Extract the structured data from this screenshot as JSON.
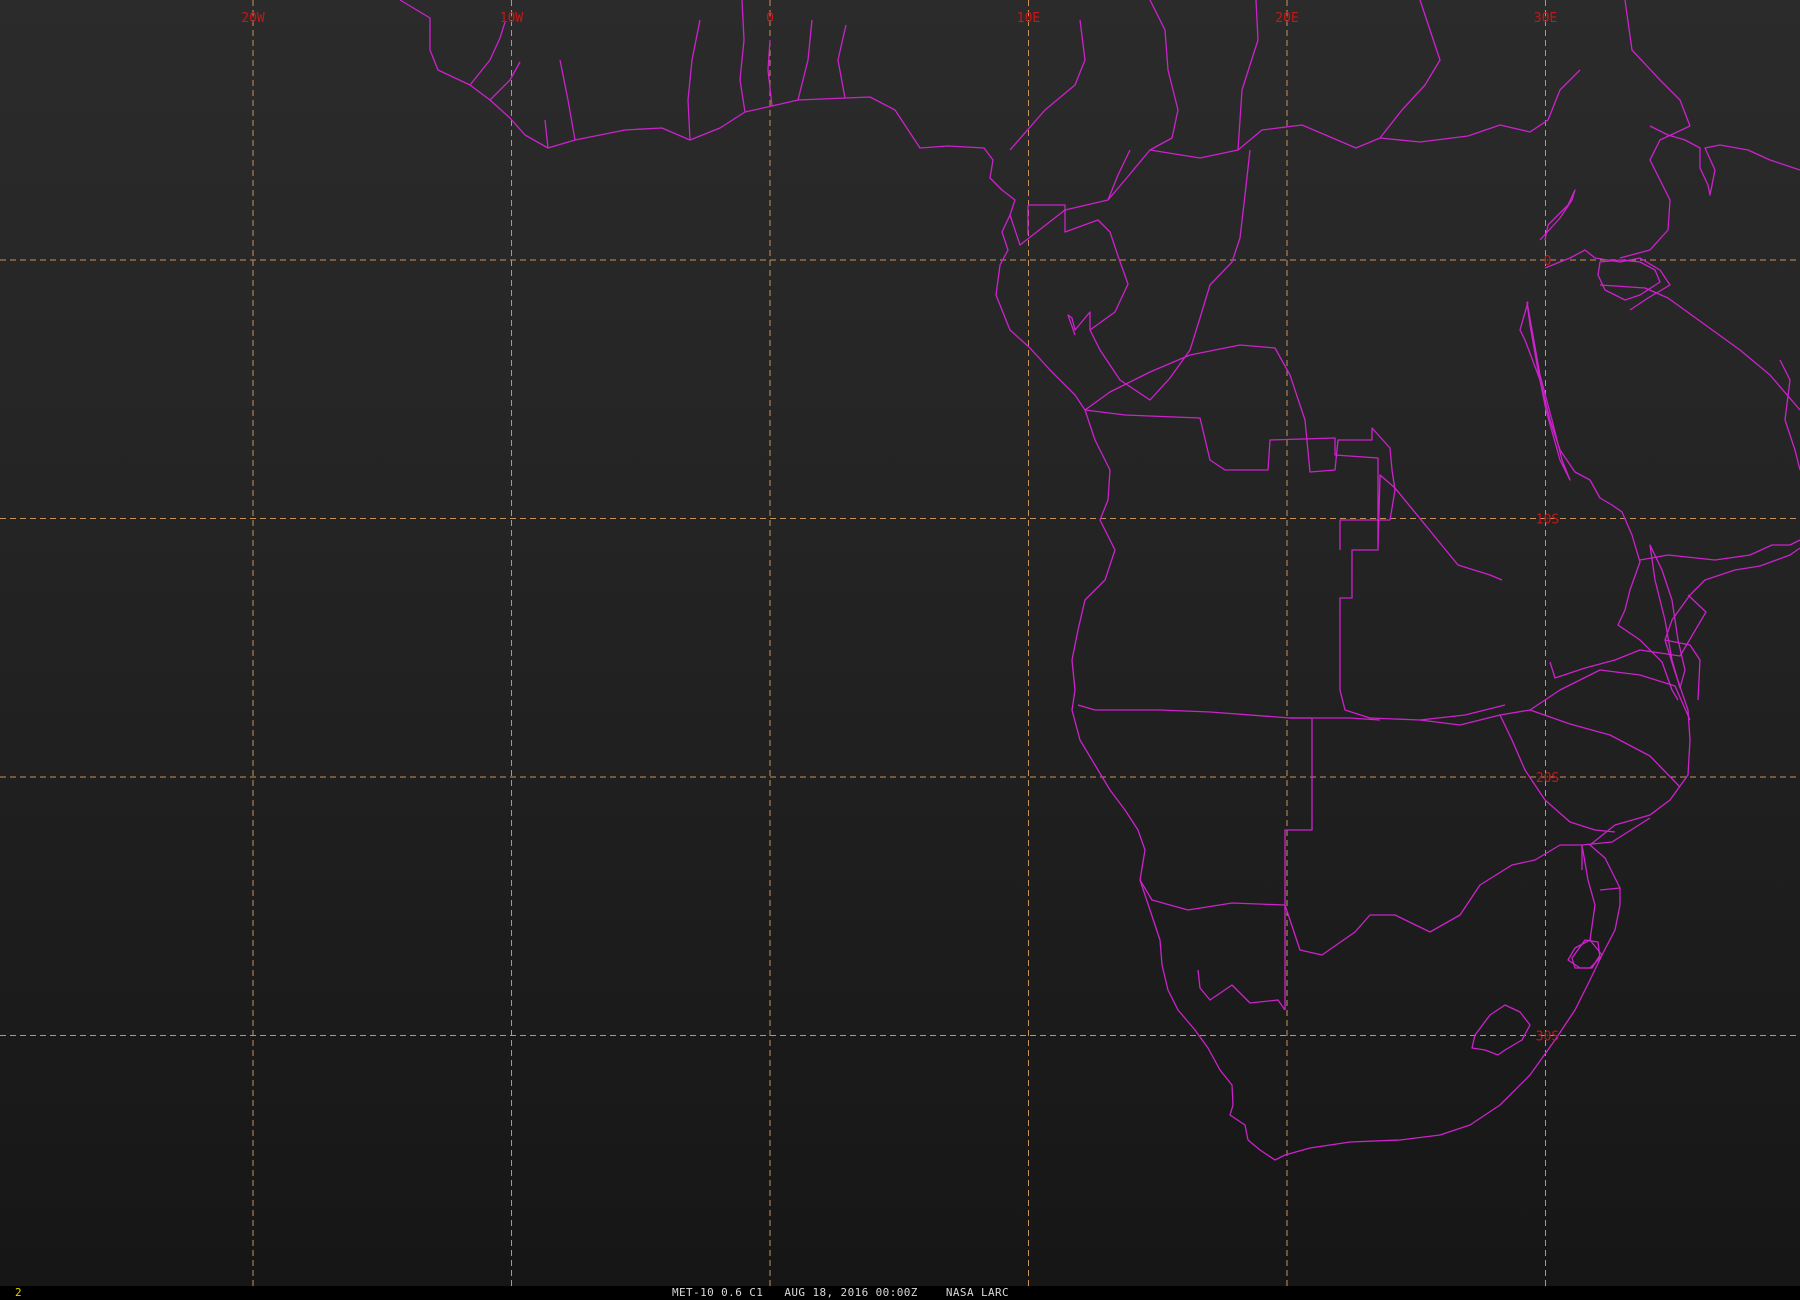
{
  "colors": {
    "graticule": "#c8935a",
    "labels": "#c41818",
    "borders": "#cc22cc",
    "caption": "#d8d8d8",
    "frame_number": "#e6d400"
  },
  "graticule": {
    "longitudes": [
      {
        "deg": -20,
        "label": "20W"
      },
      {
        "deg": -10,
        "label": "10W"
      },
      {
        "deg": 0,
        "label": "0"
      },
      {
        "deg": 10,
        "label": "10E"
      },
      {
        "deg": 20,
        "label": "20E"
      },
      {
        "deg": 30,
        "label": "30E"
      }
    ],
    "latitudes": [
      {
        "deg": 0,
        "label": "0"
      },
      {
        "deg": -10,
        "label": "10S"
      },
      {
        "deg": -20,
        "label": "20S"
      },
      {
        "deg": -30,
        "label": "30S"
      }
    ]
  },
  "status": {
    "frame_number": "2",
    "caption": "MET-10 0.6 C1   AUG 18, 2016 00:00Z    NASA LARC"
  }
}
